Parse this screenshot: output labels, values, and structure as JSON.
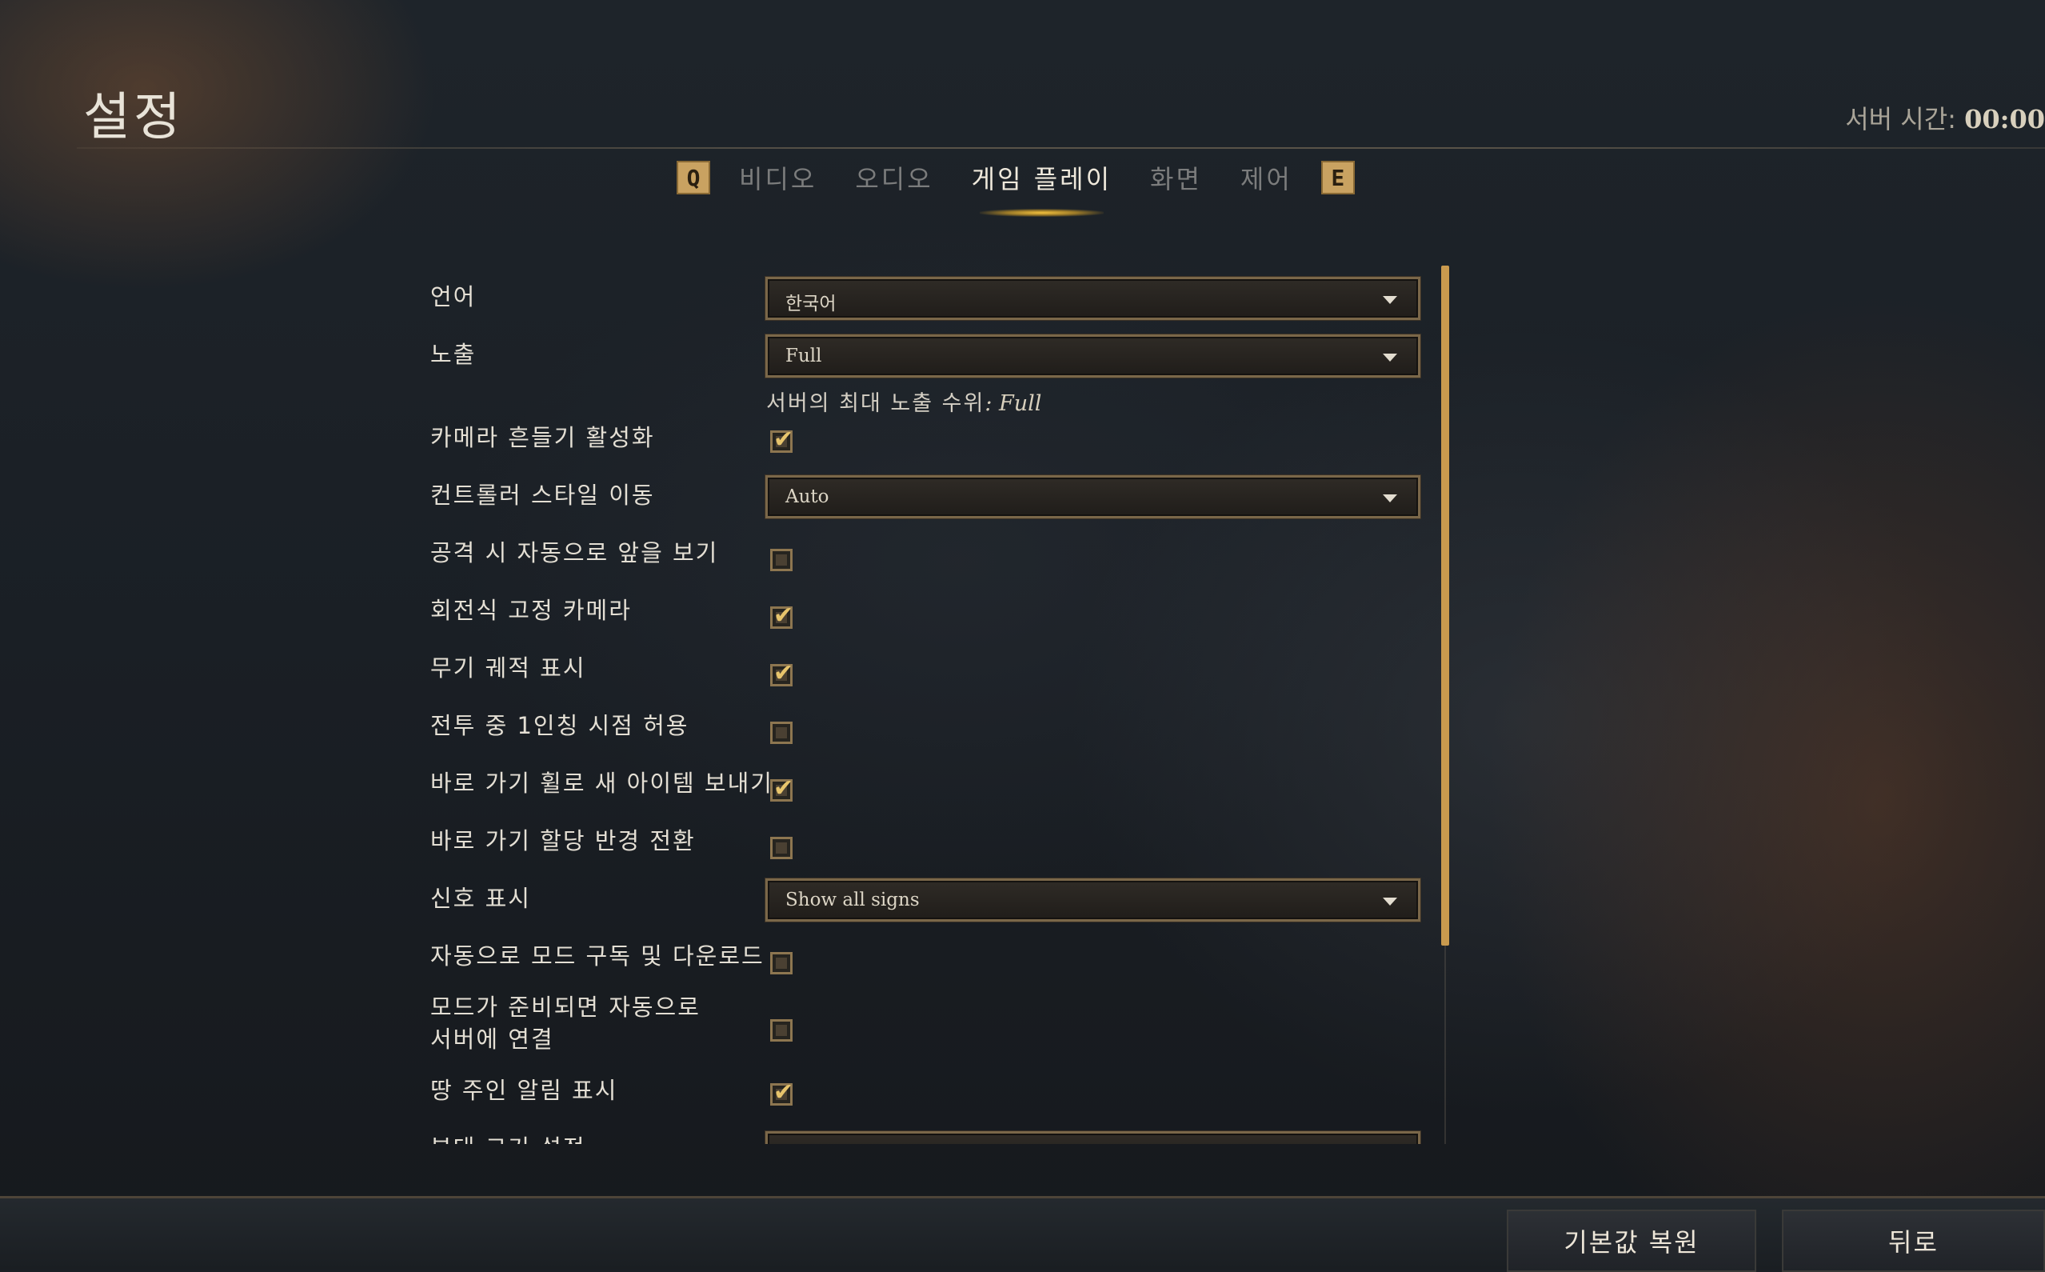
{
  "title": "설정",
  "server_time": {
    "label": "서버 시간:",
    "value": "00:00"
  },
  "tabs": {
    "prev_key": "Q",
    "next_key": "E",
    "items": [
      {
        "label": "비디오",
        "active": false
      },
      {
        "label": "오디오",
        "active": false
      },
      {
        "label": "게임 플레이",
        "active": true
      },
      {
        "label": "화면",
        "active": false
      },
      {
        "label": "제어",
        "active": false
      }
    ]
  },
  "settings": {
    "language": {
      "label": "언어",
      "value": "한국어"
    },
    "exposure": {
      "label": "노출",
      "value": "Full",
      "note_label": "서버의 최대 노출 수위",
      "note_value": ": Full"
    },
    "camera_shake": {
      "label": "카메라 흔들기 활성화",
      "checked": true
    },
    "controller_move": {
      "label": "컨트롤러 스타일 이동",
      "value": "Auto"
    },
    "auto_face_attack": {
      "label": "공격 시 자동으로 앞을 보기",
      "checked": false
    },
    "rotating_camera": {
      "label": "회전식 고정 카메라",
      "checked": true
    },
    "weapon_trails": {
      "label": "무기 궤적 표시",
      "checked": true
    },
    "first_person_combat": {
      "label": "전투 중 1인칭 시점 허용",
      "checked": false
    },
    "hotbar_new_items": {
      "label": "바로 가기 휠로 새 아이템 보내기",
      "checked": true
    },
    "hotbar_mirror": {
      "label": "바로 가기 할당 반경 전환",
      "checked": false
    },
    "signs": {
      "label": "신호 표시",
      "value": "Show all signs"
    },
    "auto_mods": {
      "label": "자동으로 모드 구독 및 다운로드",
      "checked": false
    },
    "auto_connect": {
      "label_line1": "모드가 준비되면 자동으로",
      "label_line2": "서버에 연결",
      "checked": false
    },
    "landlord_notify": {
      "label": "땅 주인 알림 표시",
      "checked": true
    },
    "partial_row": {
      "label": "부대 크기 설정"
    }
  },
  "footer": {
    "restore_defaults": "기본값 복원",
    "back": "뒤로"
  },
  "colors": {
    "accent": "#c99a4e",
    "tab_glow": "#f4c23e",
    "check": "#e7c46c"
  }
}
